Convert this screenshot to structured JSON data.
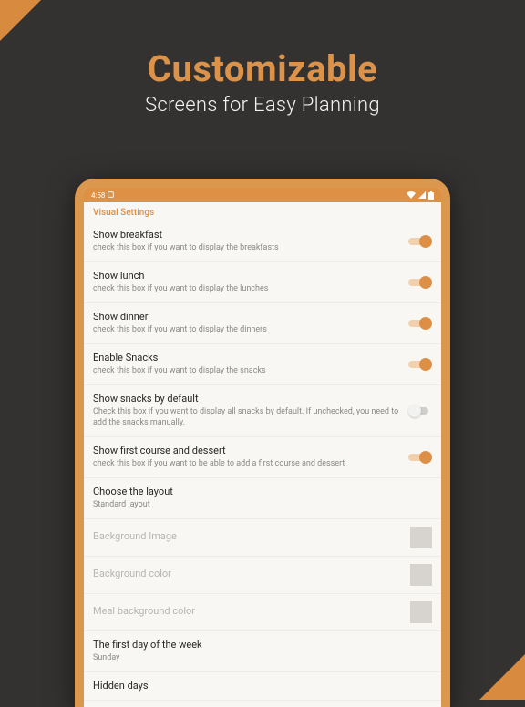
{
  "hero": {
    "title": "Customizable",
    "subtitle": "Screens for Easy Planning"
  },
  "status": {
    "time": "4:58",
    "icon_label": "🔒"
  },
  "section_title": "Visual Settings",
  "rows": [
    {
      "title": "Show breakfast",
      "sub": "check this box if you want to display the breakfasts",
      "toggle": "on"
    },
    {
      "title": "Show lunch",
      "sub": "check this box if you want to display the lunches",
      "toggle": "on"
    },
    {
      "title": "Show dinner",
      "sub": "check this box if you want to display the dinners",
      "toggle": "on"
    },
    {
      "title": "Enable Snacks",
      "sub": "check this box if you want to display the snacks",
      "toggle": "on"
    },
    {
      "title": "Show snacks by default",
      "sub": "Check this box if you want to display all snacks by default. If unchecked, you need to add the snacks manually.",
      "toggle": "off"
    },
    {
      "title": "Show first course and dessert",
      "sub": "check this box if you want to be able to add a first course and dessert",
      "toggle": "on"
    },
    {
      "title": "Choose the layout",
      "sub": "Standard layout"
    },
    {
      "title": "Background Image",
      "disabled": true,
      "swatch": true
    },
    {
      "title": "Background color",
      "disabled": true,
      "swatch": true
    },
    {
      "title": "Meal background color",
      "disabled": true,
      "swatch": true
    },
    {
      "title": "The first day of the week",
      "sub": "Sunday"
    },
    {
      "title": "Hidden days"
    }
  ]
}
